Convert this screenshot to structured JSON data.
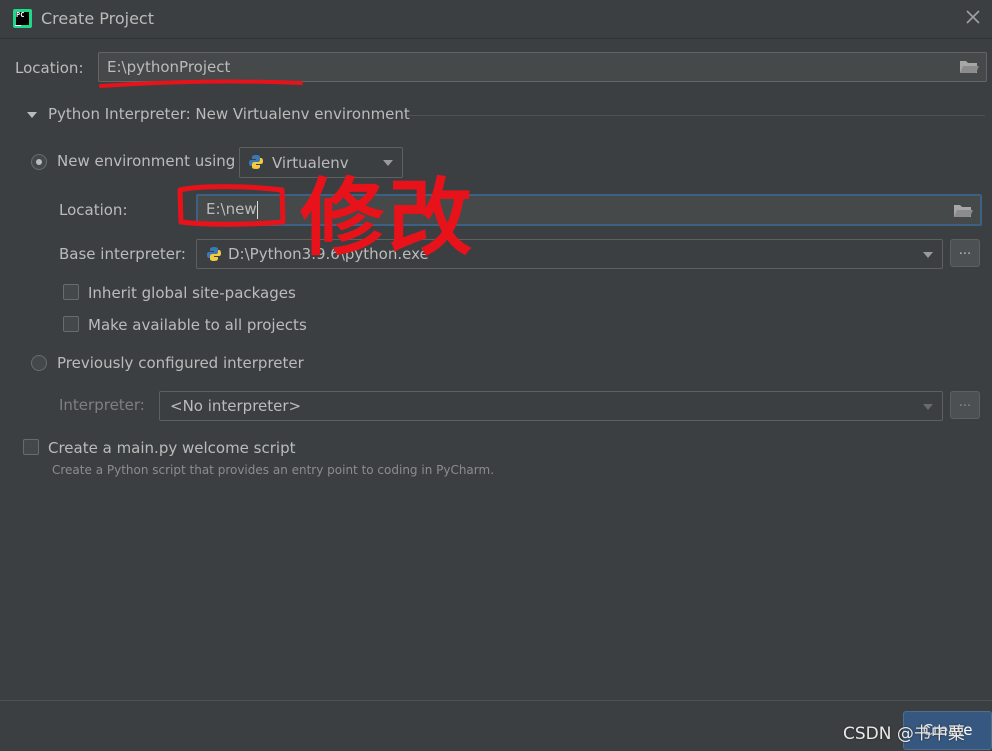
{
  "window": {
    "title": "Create Project",
    "logo_text": "PC"
  },
  "project": {
    "location_label": "Location:",
    "location_value": "E:\\pythonProject"
  },
  "interpreter_section": {
    "header": "Python Interpreter: New Virtualenv environment"
  },
  "new_env": {
    "radio_label": "New environment using",
    "tool_selected": "Virtualenv",
    "location_label": "Location:",
    "location_value": "E:\\new",
    "base_label": "Base interpreter:",
    "base_value": "D:\\Python3.9.6\\python.exe",
    "inherit_label": "Inherit global site-packages",
    "available_label": "Make available to all projects",
    "browse_label": "..."
  },
  "prev_env": {
    "radio_label": "Previously configured interpreter",
    "interpreter_label": "Interpreter:",
    "interpreter_value": "<No interpreter>",
    "browse_label": "..."
  },
  "welcome": {
    "checkbox_label": "Create a main.py welcome script",
    "hint": "Create a Python script that provides an entry point to coding in PyCharm."
  },
  "footer": {
    "create_label": "Create"
  },
  "watermark": "CSDN @书中粟",
  "annotation": {
    "text": "修改",
    "color": "#e8121b"
  },
  "colors": {
    "background": "#3c3f41",
    "field": "#45494a",
    "focus_border": "#3d6185",
    "accent": "#365880"
  }
}
